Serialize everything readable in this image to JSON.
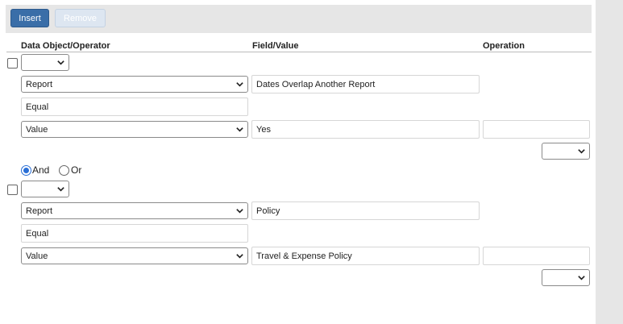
{
  "toolbar": {
    "insert_label": "Insert",
    "remove_label": "Remove"
  },
  "columns": {
    "data_object": "Data Object/Operator",
    "field_value": "Field/Value",
    "operation": "Operation"
  },
  "conditions": [
    {
      "operator_select": "",
      "rows": [
        {
          "type": "select",
          "value": "Report",
          "field": "Dates Overlap Another Report"
        },
        {
          "type": "text",
          "value": "Equal"
        },
        {
          "type": "select",
          "value": "Value",
          "field": "Yes",
          "operation": ""
        }
      ],
      "trailing_select": ""
    },
    {
      "operator_select": "",
      "rows": [
        {
          "type": "select",
          "value": "Report",
          "field": "Policy"
        },
        {
          "type": "text",
          "value": "Equal"
        },
        {
          "type": "select",
          "value": "Value",
          "field": "Travel & Expense Policy",
          "operation": ""
        }
      ],
      "trailing_select": ""
    }
  ],
  "logic": {
    "and_label": "And",
    "or_label": "Or",
    "selected": "And"
  },
  "colors": {
    "primary_button": "#3a6ea8",
    "disabled_button": "#dde6f1",
    "radio_selected": "#2a6fd6",
    "panel_bg": "#e6e6e6"
  }
}
